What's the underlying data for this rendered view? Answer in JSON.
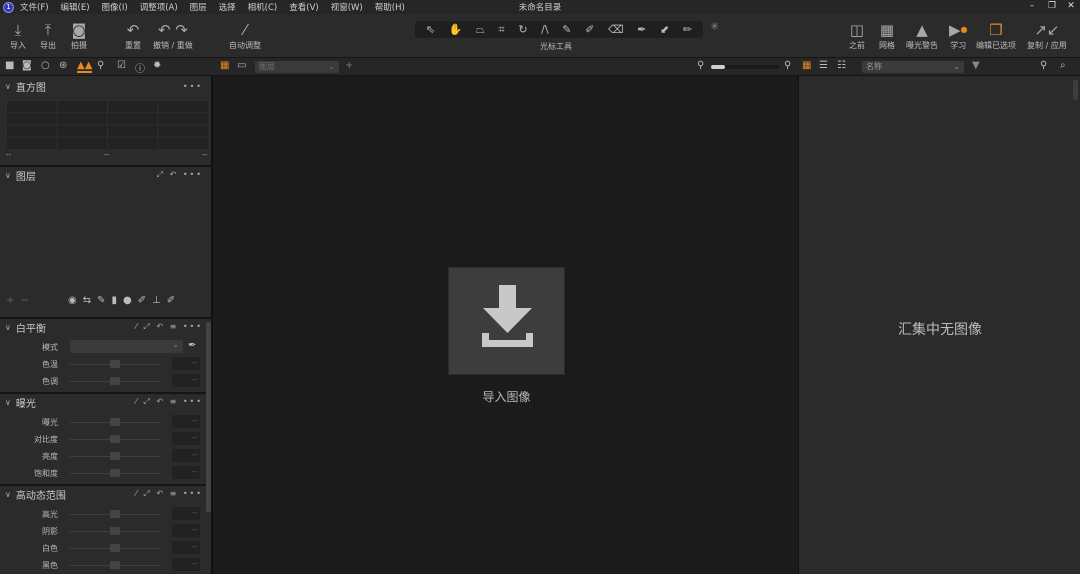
{
  "app": {
    "title": "未命名目录"
  },
  "menu": [
    "文件(F)",
    "编辑(E)",
    "图像(I)",
    "调整项(A)",
    "图层",
    "选择",
    "相机(C)",
    "查看(V)",
    "视窗(W)",
    "帮助(H)"
  ],
  "toolbar": {
    "import": "导入",
    "export": "导出",
    "capture": "拍摄",
    "reset": "重置",
    "undo_redo": "撤销 / 重做",
    "auto_adjust": "自动调整",
    "cursor_tools": "光标工具",
    "before": "之前",
    "grid": "网格",
    "exposure_warning": "曝光警告",
    "learn": "学习",
    "edit_selected": "编辑已选项",
    "copy_apply": "复制 / 应用"
  },
  "viewer_bar": {
    "layer_select": "图层"
  },
  "browser_bar": {
    "sort_select": "名称"
  },
  "histogram": {
    "title": "直方图",
    "min": "--",
    "mid": "--",
    "max": "--"
  },
  "layers": {
    "title": "图层"
  },
  "white_balance": {
    "title": "白平衡",
    "mode_label": "模式",
    "mode_value": "",
    "rows": [
      {
        "label": "色温",
        "value": "--"
      },
      {
        "label": "色调",
        "value": "--"
      }
    ]
  },
  "exposure": {
    "title": "曝光",
    "rows": [
      {
        "label": "曝光",
        "value": "--"
      },
      {
        "label": "对比度",
        "value": "--"
      },
      {
        "label": "亮度",
        "value": "--"
      },
      {
        "label": "饱和度",
        "value": "--"
      }
    ]
  },
  "hdr": {
    "title": "高动态范围",
    "rows": [
      {
        "label": "高光",
        "value": "--"
      },
      {
        "label": "阴影",
        "value": "--"
      },
      {
        "label": "白色",
        "value": "--"
      },
      {
        "label": "黑色",
        "value": "--"
      }
    ]
  },
  "viewer": {
    "import_label": "导入图像"
  },
  "browser": {
    "empty_text": "汇集中无图像"
  },
  "colors": {
    "accent": "#e8891f"
  }
}
